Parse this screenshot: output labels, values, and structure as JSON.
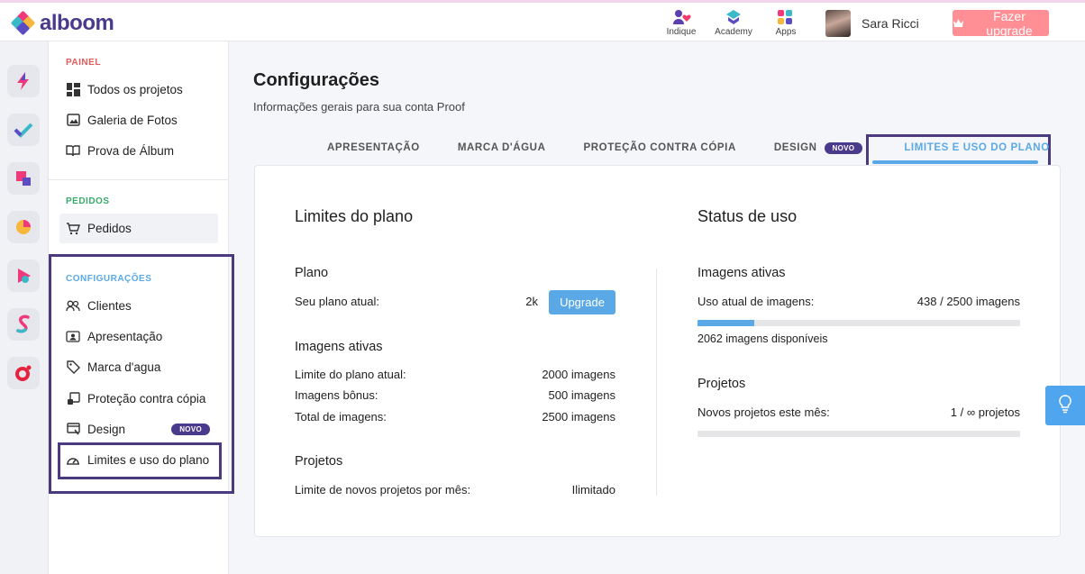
{
  "brand": {
    "name": "alboom"
  },
  "topbar": {
    "links": [
      {
        "label": "Indique",
        "icon": "people-heart-icon"
      },
      {
        "label": "Academy",
        "icon": "academy-icon"
      },
      {
        "label": "Apps",
        "icon": "apps-grid-icon"
      }
    ],
    "user_name": "Sara Ricci",
    "upgrade_label": "Fazer upgrade"
  },
  "rail": {
    "icons": [
      "bolt-app-icon",
      "check-app-icon",
      "square-app-icon",
      "pie-app-icon",
      "play-app-icon",
      "s-app-icon",
      "ring-app-icon"
    ]
  },
  "sidebar": {
    "painel": {
      "label": "PAINEL",
      "items": [
        {
          "label": "Todos os projetos",
          "icon": "grid-icon"
        },
        {
          "label": "Galeria de Fotos",
          "icon": "image-icon"
        },
        {
          "label": "Prova de Álbum",
          "icon": "book-icon"
        }
      ]
    },
    "pedidos": {
      "label": "PEDIDOS",
      "items": [
        {
          "label": "Pedidos",
          "icon": "cart-icon"
        }
      ]
    },
    "config": {
      "label": "CONFIGURAÇÕES",
      "items": [
        {
          "label": "Clientes",
          "icon": "users-icon"
        },
        {
          "label": "Apresentação",
          "icon": "id-card-icon"
        },
        {
          "label": "Marca d'agua",
          "icon": "tag-icon"
        },
        {
          "label": "Proteção contra cópia",
          "icon": "copy-lock-icon"
        },
        {
          "label": "Design",
          "icon": "design-icon",
          "badge": "NOVO"
        },
        {
          "label": "Limites e uso do plano",
          "icon": "gauge-icon"
        }
      ]
    }
  },
  "page": {
    "title": "Configurações",
    "subtitle": "Informações gerais para sua conta Proof"
  },
  "tabs": [
    {
      "label": "APRESENTAÇÃO"
    },
    {
      "label": "MARCA D'ÁGUA"
    },
    {
      "label": "PROTEÇÃO CONTRA CÓPIA"
    },
    {
      "label": "DESIGN",
      "badge": "NOVO"
    },
    {
      "label": "LIMITES E USO DO PLANO",
      "active": true
    }
  ],
  "limits": {
    "title": "Limites do plano",
    "plano": {
      "heading": "Plano",
      "current_label": "Seu plano atual:",
      "current_value": "2k",
      "upgrade_label": "Upgrade"
    },
    "imagens": {
      "heading": "Imagens ativas",
      "rows": [
        {
          "label": "Limite do plano atual:",
          "value": "2000 imagens"
        },
        {
          "label": "Imagens bônus:",
          "value": "500 imagens"
        },
        {
          "label": "Total de imagens:",
          "value": "2500 imagens"
        }
      ]
    },
    "projetos": {
      "heading": "Projetos",
      "label": "Limite de novos projetos por mês:",
      "value": "Ilimitado"
    }
  },
  "status": {
    "title": "Status de uso",
    "imagens": {
      "heading": "Imagens ativas",
      "label": "Uso atual de imagens:",
      "value": "438 / 2500 imagens",
      "used": 438,
      "total": 2500,
      "available": "2062 imagens disponíveis"
    },
    "projetos": {
      "heading": "Projetos",
      "label": "Novos projetos este mês:",
      "value": "1 / ∞ projetos",
      "fraction": 0
    }
  },
  "colors": {
    "accent": "#5aa9e6",
    "brand": "#4a3a8c",
    "upgrade": "#ff8e95",
    "highlight": "#4b3a7e"
  }
}
